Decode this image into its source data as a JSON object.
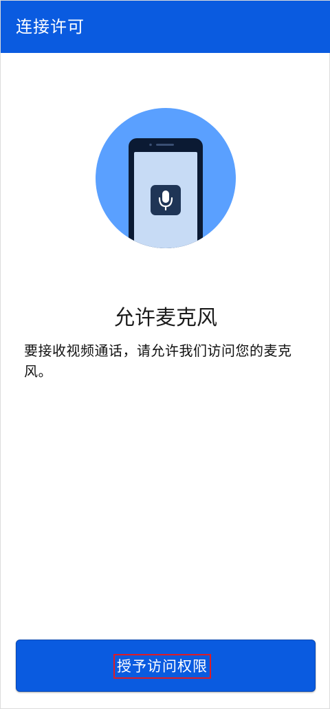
{
  "app_bar": {
    "title": "连接许可"
  },
  "illustration": {
    "icons": [
      "smartphone-icon",
      "microphone-icon"
    ],
    "colors": {
      "circle": "#5aa0ff",
      "phone_body": "#0b1a33",
      "phone_screen": "#c7dbf5",
      "mic_tile": "#1f3556"
    }
  },
  "content": {
    "heading": "允许麦克风",
    "description": "要接收视频通话，请允许我们访问您的麦克风。"
  },
  "actions": {
    "grant_button_label": "授予访问权限"
  },
  "colors": {
    "accent": "#0a5be0",
    "highlight_border": "#e01b24"
  }
}
